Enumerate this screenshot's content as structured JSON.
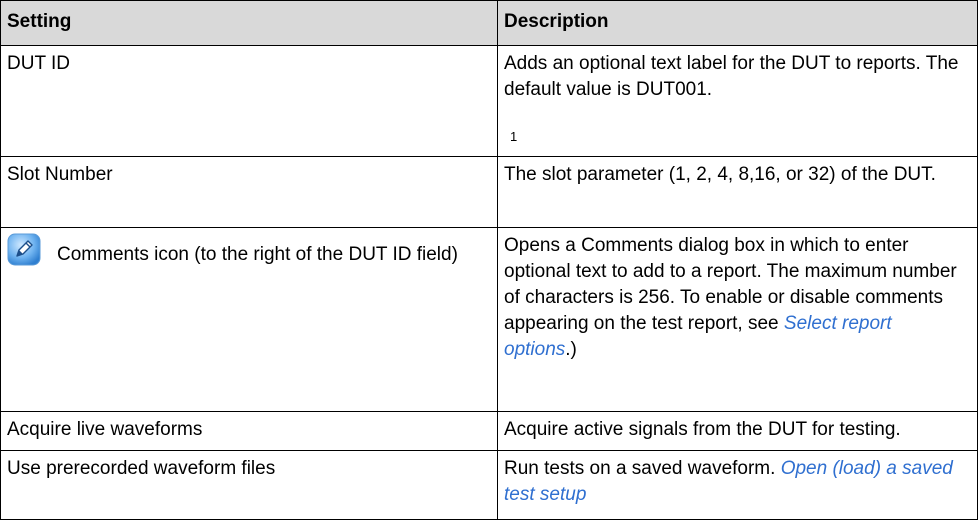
{
  "table": {
    "headers": {
      "setting": "Setting",
      "description": "Description"
    },
    "rows": [
      {
        "setting": "DUT ID",
        "description": "Adds an optional text label for the DUT to reports. The default value is DUT001.",
        "footnote": "1"
      },
      {
        "setting": "Slot Number",
        "description": "The slot parameter (1, 2, 4, 8,16, or 32) of the DUT."
      },
      {
        "setting": "Comments icon (to the right of the DUT ID field)",
        "icon": "comments-edit-icon",
        "description_pre": "Opens a Comments dialog box in which to enter optional text to add to a report. The maximum number of characters is 256. To enable or disable comments appearing on the test report, see ",
        "description_link": "Select report options",
        "description_post": ".)"
      },
      {
        "setting": "Acquire live waveforms",
        "description": "Acquire active signals from the DUT for testing."
      },
      {
        "setting": "Use prerecorded waveform files",
        "description_pre": "Run tests on a saved waveform. ",
        "description_link": "Open (load) a saved test setup"
      }
    ]
  },
  "colors": {
    "header_bg": "#d9d9d9",
    "link": "#2f6fd0",
    "border": "#000000"
  }
}
